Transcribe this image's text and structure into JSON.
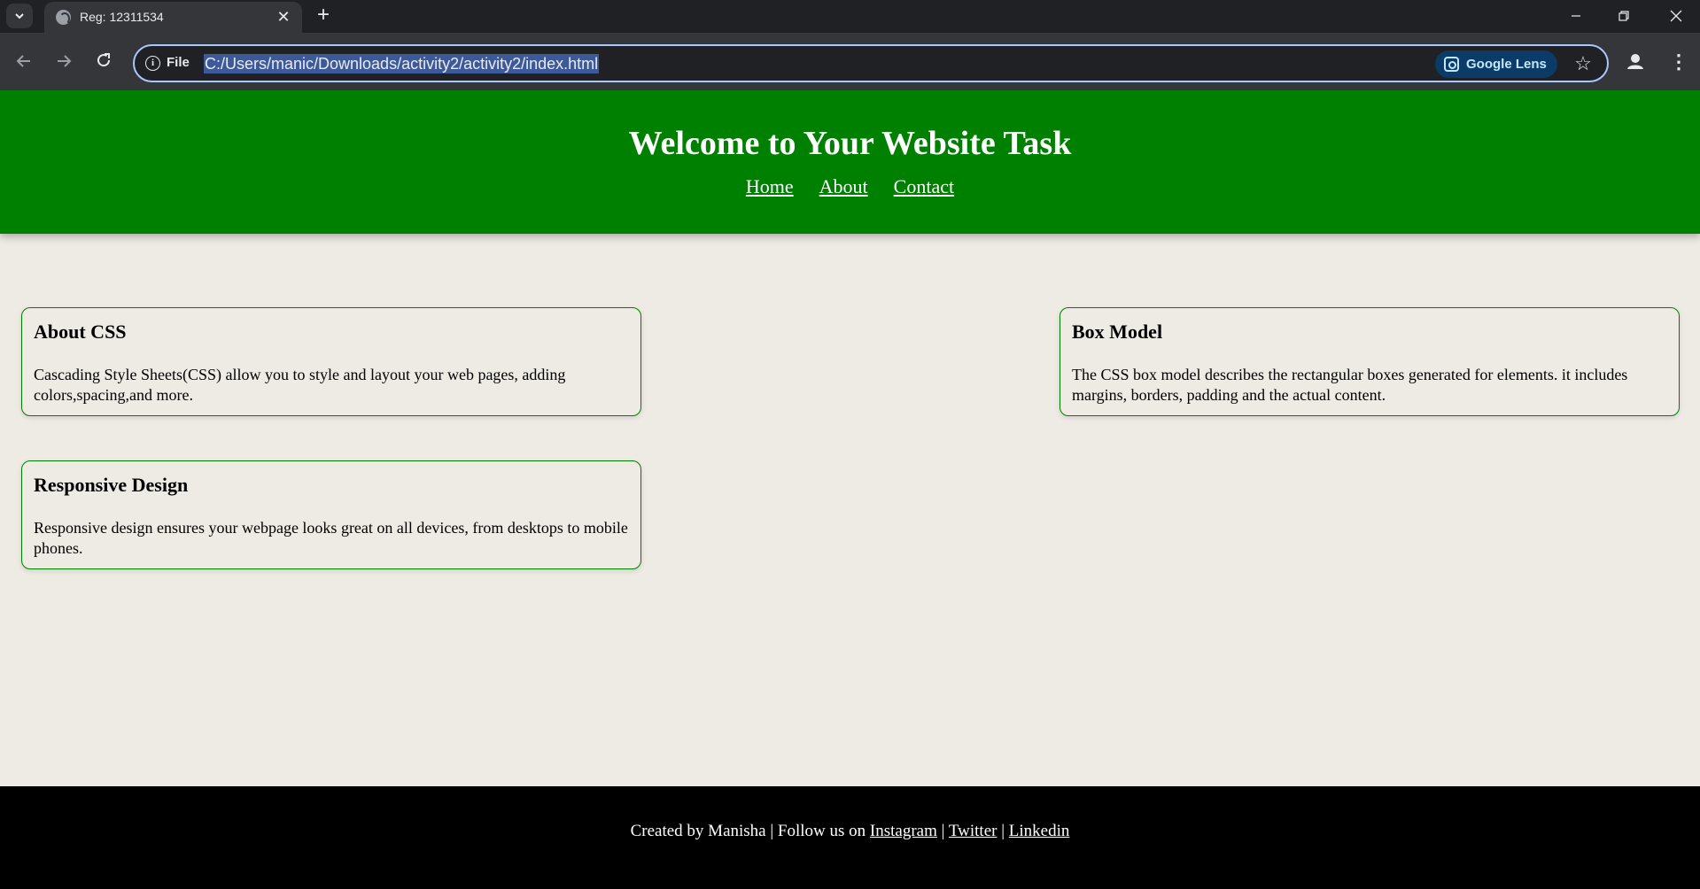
{
  "browser": {
    "tab_title": "Reg: 12311534",
    "url": "C:/Users/manic/Downloads/activity2/activity2/index.html",
    "scheme_label": "File",
    "lens_label": "Google Lens"
  },
  "header": {
    "title": "Welcome to Your Website Task",
    "nav": [
      "Home",
      "About",
      "Contact"
    ]
  },
  "cards": [
    {
      "title": "About CSS",
      "text": "Cascading Style Sheets(CSS) allow you to style and layout your web pages, adding colors,spacing,and more."
    },
    {
      "title": "Box Model",
      "text": "The CSS box model describes the rectangular boxes generated for elements. it includes margins, borders, padding and the actual content."
    },
    {
      "title": "Responsive Design",
      "text": "Responsive design ensures your webpage looks great on all devices, from desktops to mobile phones."
    }
  ],
  "footer": {
    "prefix": "Created by Manisha | Follow us on",
    "links": [
      "Instagram",
      "Twitter",
      "Linkedin"
    ],
    "separator": "|"
  },
  "colors": {
    "header_bg": "#008000",
    "page_bg": "#eeeae4",
    "footer_bg": "#000000"
  }
}
